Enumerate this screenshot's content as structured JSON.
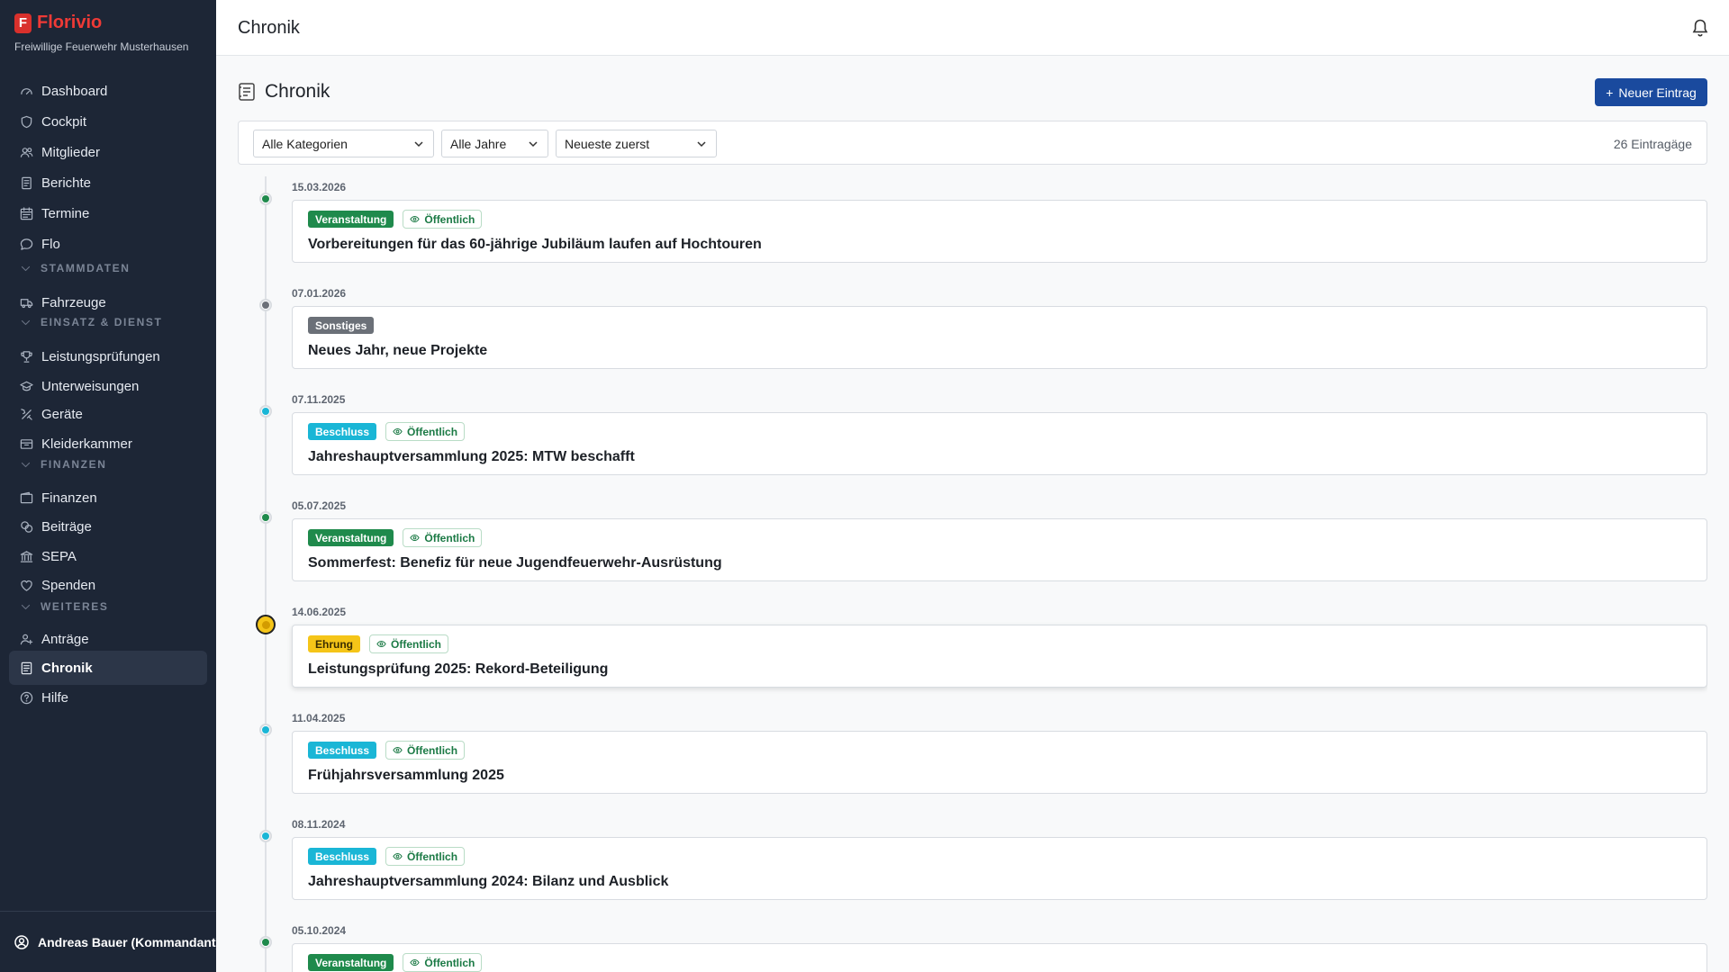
{
  "brand": {
    "name": "Florivio",
    "subtitle": "Freiwillige Feuerwehr Musterhausen",
    "logo_letter": "F"
  },
  "nav": [
    {
      "type": "item",
      "label": "Dashboard",
      "icon": "gauge-icon"
    },
    {
      "type": "item",
      "label": "Cockpit",
      "icon": "shield-icon"
    },
    {
      "type": "item",
      "label": "Mitglieder",
      "icon": "users-icon"
    },
    {
      "type": "item",
      "label": "Berichte",
      "icon": "document-icon"
    },
    {
      "type": "item",
      "label": "Termine",
      "icon": "calendar-icon"
    },
    {
      "type": "item",
      "label": "Flo",
      "icon": "chat-icon"
    },
    {
      "type": "section",
      "label": "STAMMDATEN"
    },
    {
      "type": "item",
      "label": "Fahrzeuge",
      "icon": "truck-icon"
    },
    {
      "type": "section",
      "label": "EINSATZ & DIENST"
    },
    {
      "type": "item",
      "label": "Leistungsprüfungen",
      "icon": "trophy-icon"
    },
    {
      "type": "item",
      "label": "Unterweisungen",
      "icon": "graduation-cap-icon"
    },
    {
      "type": "item",
      "label": "Geräte",
      "icon": "tools-icon"
    },
    {
      "type": "item",
      "label": "Kleiderkammer",
      "icon": "box-icon"
    },
    {
      "type": "section",
      "label": "FINANZEN"
    },
    {
      "type": "item",
      "label": "Finanzen",
      "icon": "wallet-icon"
    },
    {
      "type": "item",
      "label": "Beiträge",
      "icon": "coins-icon"
    },
    {
      "type": "item",
      "label": "SEPA",
      "icon": "bank-icon"
    },
    {
      "type": "item",
      "label": "Spenden",
      "icon": "heart-icon"
    },
    {
      "type": "section",
      "label": "WEITERES"
    },
    {
      "type": "item",
      "label": "Anträge",
      "icon": "user-plus-icon"
    },
    {
      "type": "item",
      "label": "Chronik",
      "icon": "chronicle-icon",
      "active": true
    },
    {
      "type": "item",
      "label": "Hilfe",
      "icon": "help-icon"
    }
  ],
  "user": {
    "label": "Andreas Bauer (Kommandant)"
  },
  "header": {
    "title": "Chronik"
  },
  "page": {
    "title": "Chronik",
    "new_button": "Neuer Eintrag"
  },
  "filters": {
    "category": "Alle Kategorien",
    "year": "Alle Jahre",
    "sort": "Neueste zuerst",
    "count": "26 Eintragäge"
  },
  "public_label": "Öffentlich",
  "category_colors": {
    "Veranstaltung": "#1f8a4c",
    "Sonstiges": "#6b7078",
    "Beschluss": "#1ab6d6",
    "Ehrung": "#f5c518"
  },
  "entries": [
    {
      "date": "15.03.2026",
      "category": "Veranstaltung",
      "public": true,
      "title": "Vorbereitungen für das 60-jährige Jubiläum laufen auf Hochtouren"
    },
    {
      "date": "07.01.2026",
      "category": "Sonstiges",
      "public": false,
      "title": "Neues Jahr, neue Projekte"
    },
    {
      "date": "07.11.2025",
      "category": "Beschluss",
      "public": true,
      "title": "Jahreshauptversammlung 2025: MTW beschafft"
    },
    {
      "date": "05.07.2025",
      "category": "Veranstaltung",
      "public": true,
      "title": "Sommerfest: Benefiz für neue Jugendfeuerwehr-Ausrüstung"
    },
    {
      "date": "14.06.2025",
      "category": "Ehrung",
      "public": true,
      "title": "Leistungsprüfung 2025: Rekord-Beteiligung",
      "highlighted": true
    },
    {
      "date": "11.04.2025",
      "category": "Beschluss",
      "public": true,
      "title": "Frühjahrsversammlung 2025"
    },
    {
      "date": "08.11.2024",
      "category": "Beschluss",
      "public": true,
      "title": "Jahreshauptversammlung 2024: Bilanz und Ausblick"
    },
    {
      "date": "05.10.2024",
      "category": "Veranstaltung",
      "public": true,
      "title": ""
    }
  ]
}
